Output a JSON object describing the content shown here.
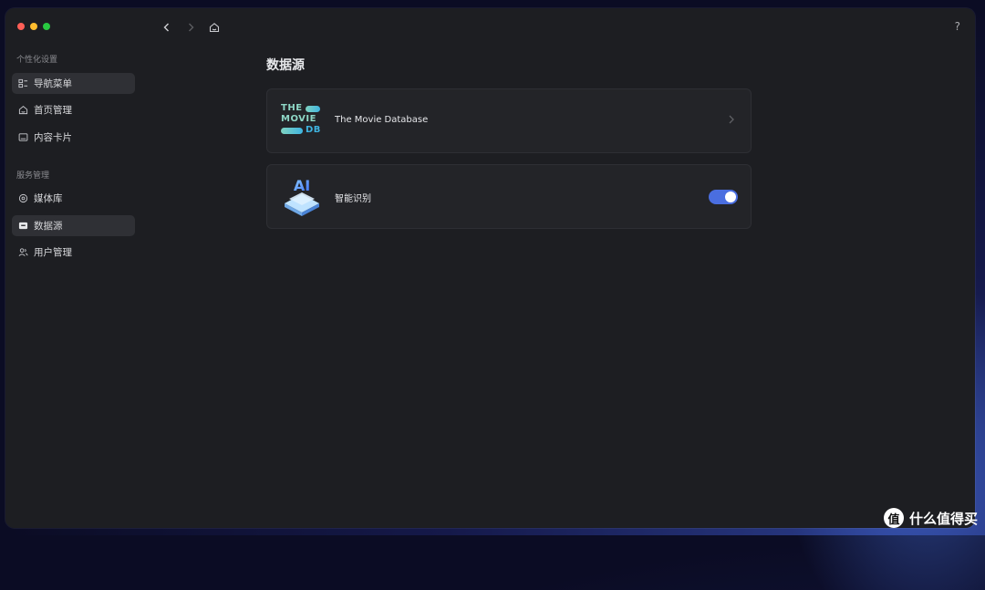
{
  "window": {
    "sidebar": {
      "section_personal": "个性化设置",
      "personal_items": [
        {
          "label": "导航菜单",
          "icon": "list-icon",
          "active": true
        },
        {
          "label": "首页管理",
          "icon": "home-icon",
          "active": false
        },
        {
          "label": "内容卡片",
          "icon": "card-icon",
          "active": false
        }
      ],
      "section_service": "服务管理",
      "service_items": [
        {
          "label": "媒体库",
          "icon": "library-icon",
          "active": false
        },
        {
          "label": "数据源",
          "icon": "datasource-icon",
          "active": true
        },
        {
          "label": "用户管理",
          "icon": "users-icon",
          "active": false
        }
      ]
    },
    "toolbar": {
      "back_icon": "chevron-left-icon",
      "forward_icon": "chevron-right-icon",
      "home_icon": "home-icon",
      "help": "?"
    },
    "main": {
      "title": "数据源",
      "sources": [
        {
          "name": "The Movie Database",
          "logo": "tmdb-logo",
          "logo_text": [
            "THE",
            "MOVIE",
            "DB"
          ],
          "action": "chevron-right-icon"
        },
        {
          "name": "智能识别",
          "logo": "ai-logo",
          "logo_text": "AI",
          "toggle_on": true
        }
      ]
    }
  },
  "watermark": {
    "badge": "值",
    "text": "什么值得买"
  },
  "colors": {
    "accent": "#4a6ee0",
    "window_bg": "#1d1e22",
    "card_bg": "#232428"
  }
}
